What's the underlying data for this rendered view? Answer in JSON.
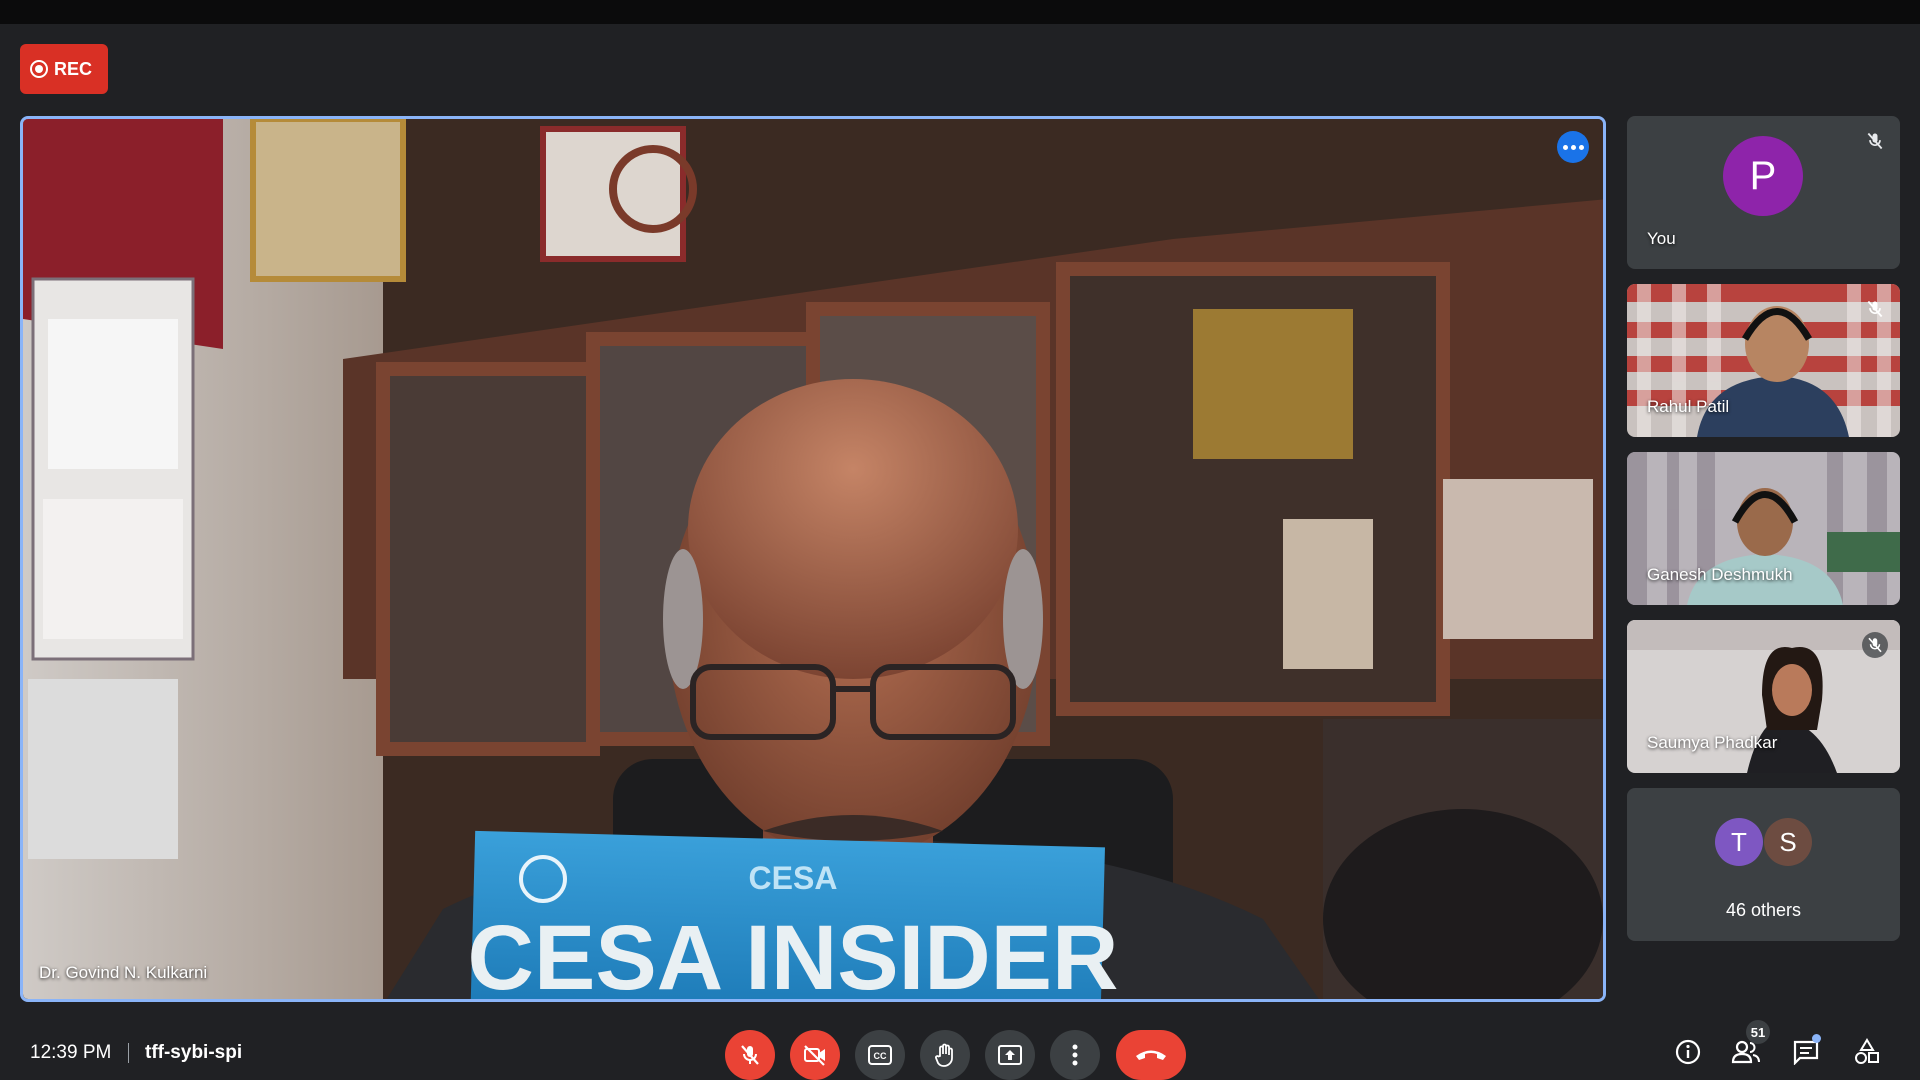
{
  "recording": {
    "label": "REC"
  },
  "main_tile": {
    "name": "Dr. Govind N. Kulkarni",
    "magazine_title": "CESA INSIDER",
    "magazine_logo": "CESA"
  },
  "participants": [
    {
      "name": "You",
      "avatar_letter": "P",
      "avatar_color": "#8e24aa",
      "muted": true
    },
    {
      "name": "Rahul Patil",
      "muted": true
    },
    {
      "name": "Ganesh Deshmukh",
      "muted": false
    },
    {
      "name": "Saumya Phadkar",
      "muted": true
    }
  ],
  "others": {
    "letters": [
      "T",
      "S"
    ],
    "colors": [
      "#7e57c2",
      "#6d4c41"
    ],
    "label": "46 others"
  },
  "meeting": {
    "time": "12:39 PM",
    "code": "tff-sybi-spi"
  },
  "controls": [
    "mic-off-icon",
    "camera-off-icon",
    "captions-icon",
    "raise-hand-icon",
    "present-icon",
    "more-options-icon",
    "end-call-icon"
  ],
  "people_count": "51",
  "colors": {
    "accent": "#8ab4f8",
    "danger": "#ea4335",
    "rec": "#d93025"
  }
}
